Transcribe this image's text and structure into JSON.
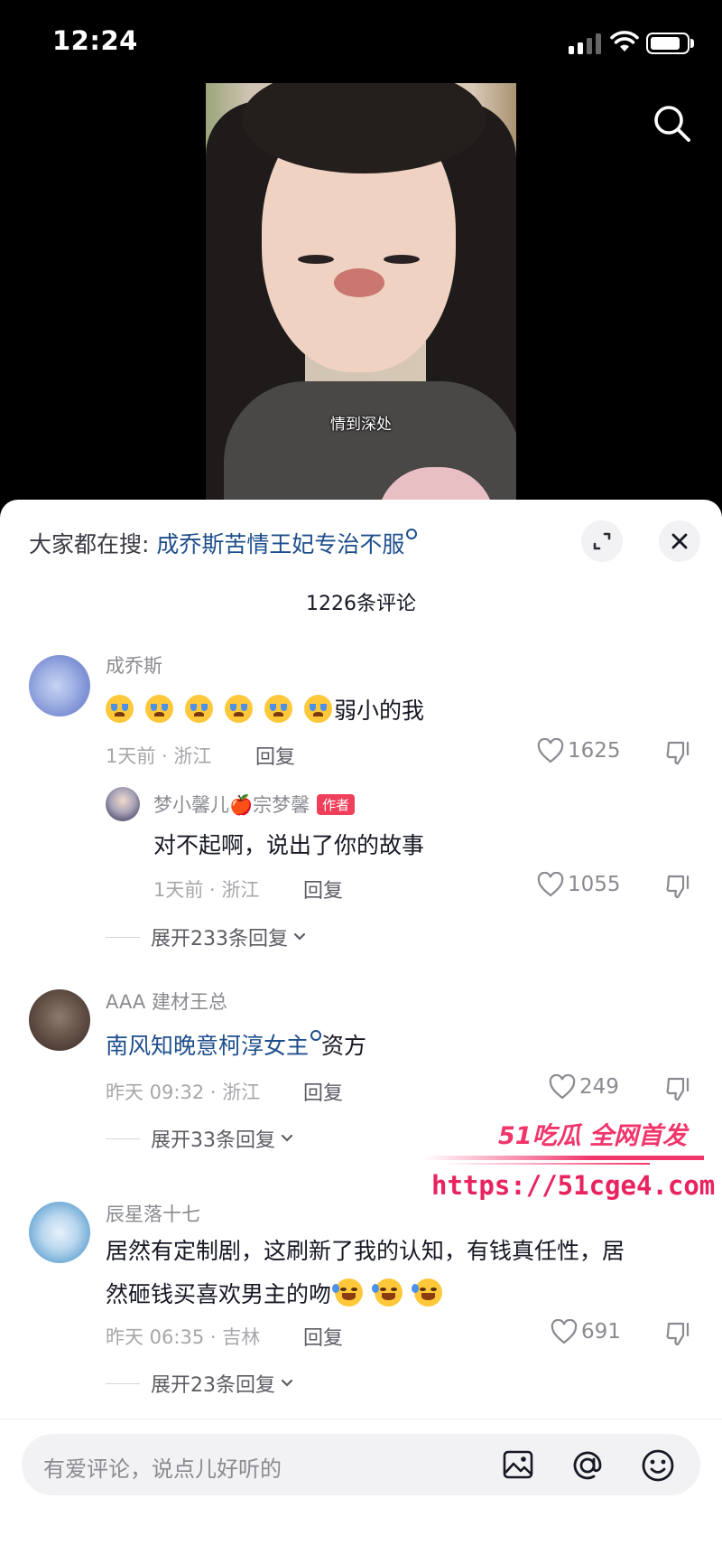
{
  "status_bar": {
    "time": "12:24",
    "battery_level": 0.85,
    "icons": [
      "signal-icon",
      "wifi-icon",
      "battery-icon"
    ]
  },
  "video": {
    "caption": "情到深处",
    "search_icon": "search-icon"
  },
  "sheet": {
    "hot_search_prefix": "大家都在搜:",
    "hot_search_link": "成乔斯苦情王妃专治不服",
    "comment_count_label": "1226条评论",
    "header_icons": [
      "expand-icon",
      "close-icon"
    ]
  },
  "comments": [
    {
      "username": "成乔斯",
      "text": "弱小的我",
      "emoji_count": 6,
      "emoji": "crying-face",
      "meta": "1天前 · 浙江",
      "reply_label": "回复",
      "likes": "1625",
      "reply": {
        "username": "梦小馨儿🍎宗梦馨",
        "badge": "作者",
        "text": "对不起啊，说出了你的故事",
        "meta": "1天前 · 浙江",
        "reply_label": "回复",
        "likes": "1055"
      },
      "expand_label": "展开233条回复"
    },
    {
      "username": "AAA 建材王总",
      "text_link": "南风知晚意柯淳女主",
      "text_suffix": "资方",
      "meta": "昨天 09:32 · 浙江",
      "reply_label": "回复",
      "likes": "249",
      "expand_label": "展开33条回复"
    },
    {
      "username": "辰星落十七",
      "text_line1": "居然有定制剧，这刷新了我的认知，有钱真任性，居",
      "text_line2": "然砸钱买喜欢男主的吻",
      "emoji": "laughing-crying-face",
      "emoji_count": 3,
      "meta": "昨天 06:35 · 吉林",
      "reply_label": "回复",
      "likes": "691",
      "expand_label": "展开23条回复"
    }
  ],
  "watermark": {
    "line1": "51吃瓜 全网首发",
    "line2": "https://51cge4.com"
  },
  "input": {
    "placeholder": "有爱评论，说点儿好听的",
    "icons": [
      "image-icon",
      "at-icon",
      "emoji-icon"
    ]
  },
  "colors": {
    "link": "#1e4e8c",
    "author_badge": "#f03f5a",
    "watermark": "#f2356b",
    "sheet_bg": "#ffffff"
  }
}
